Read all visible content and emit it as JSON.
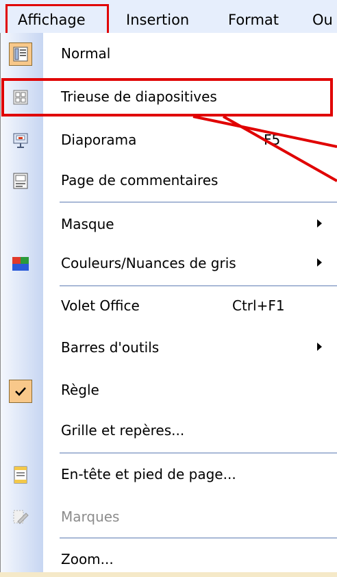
{
  "menubar": {
    "items": [
      "Affichage",
      "Insertion",
      "Format",
      "Ou"
    ]
  },
  "menu": {
    "items": [
      {
        "label": "Normal",
        "icon": "normal-view-icon"
      },
      {
        "label": "Trieuse de diapositives",
        "icon": "slide-sorter-icon"
      },
      {
        "label": "Diaporama",
        "shortcut": "F5",
        "icon": "slideshow-icon"
      },
      {
        "label": "Page de commentaires",
        "icon": "notes-page-icon"
      },
      {
        "label": "Masque",
        "submenu": true
      },
      {
        "label": "Couleurs/Nuances de gris",
        "submenu": true,
        "icon": "color-grayscale-icon"
      },
      {
        "label": "Volet Office",
        "shortcut": "Ctrl+F1"
      },
      {
        "label": "Barres d'outils",
        "submenu": true
      },
      {
        "label": "Règle",
        "checked": true,
        "icon": "checkmark-icon"
      },
      {
        "label": "Grille et repères..."
      },
      {
        "label": "En-tête et pied de page...",
        "icon": "header-footer-icon"
      },
      {
        "label": "Marques",
        "disabled": true,
        "icon": "markup-icon"
      },
      {
        "label": "Zoom..."
      }
    ]
  },
  "colors": {
    "annotation": "#e00000",
    "menubar_bg": "#e6eefc",
    "gutter_start": "#f4f7fd",
    "gutter_end": "#c7d6f2",
    "check_bg": "#f8c88a"
  }
}
